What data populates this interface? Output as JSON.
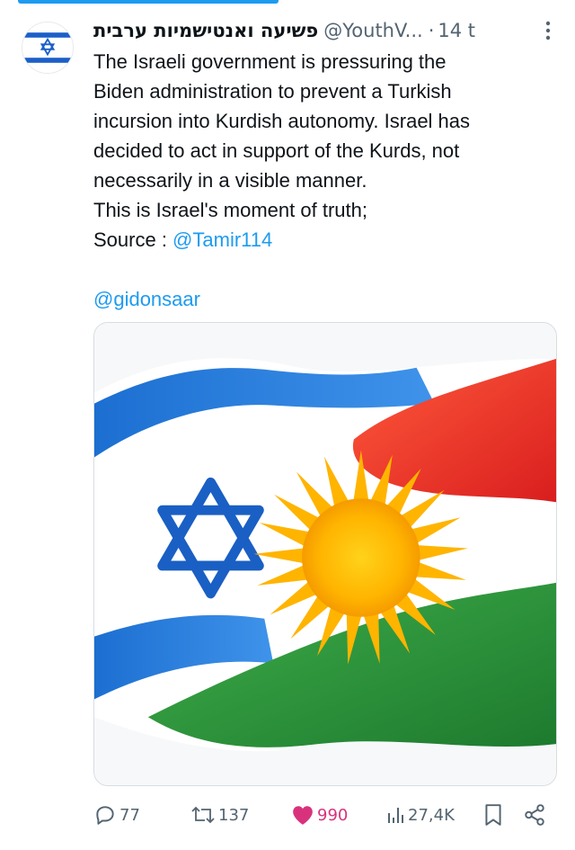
{
  "tweet": {
    "display_name": "פשיעה ואנטישמיות ערבית",
    "handle": "@YouthV...",
    "separator": "·",
    "time": "14 t",
    "text_lines": [
      "The Israeli government is pressuring the",
      "Biden administration to prevent a Turkish",
      "incursion into Kurdish autonomy. Israel has",
      "decided to act in support of the Kurds, not",
      "necessarily in a visible manner.",
      "This is Israel's moment of truth;"
    ],
    "source_label": "Source : ",
    "source_link": "@Tamir114",
    "mention": "@gidonsaar",
    "media_icon": "israel-kurdistan-flags-image"
  },
  "actions": {
    "replies": "77",
    "reposts": "137",
    "likes": "990",
    "views": "27,4K"
  },
  "colors": {
    "accent": "#1d9bf0",
    "like": "#d9327c",
    "muted": "#536471"
  }
}
